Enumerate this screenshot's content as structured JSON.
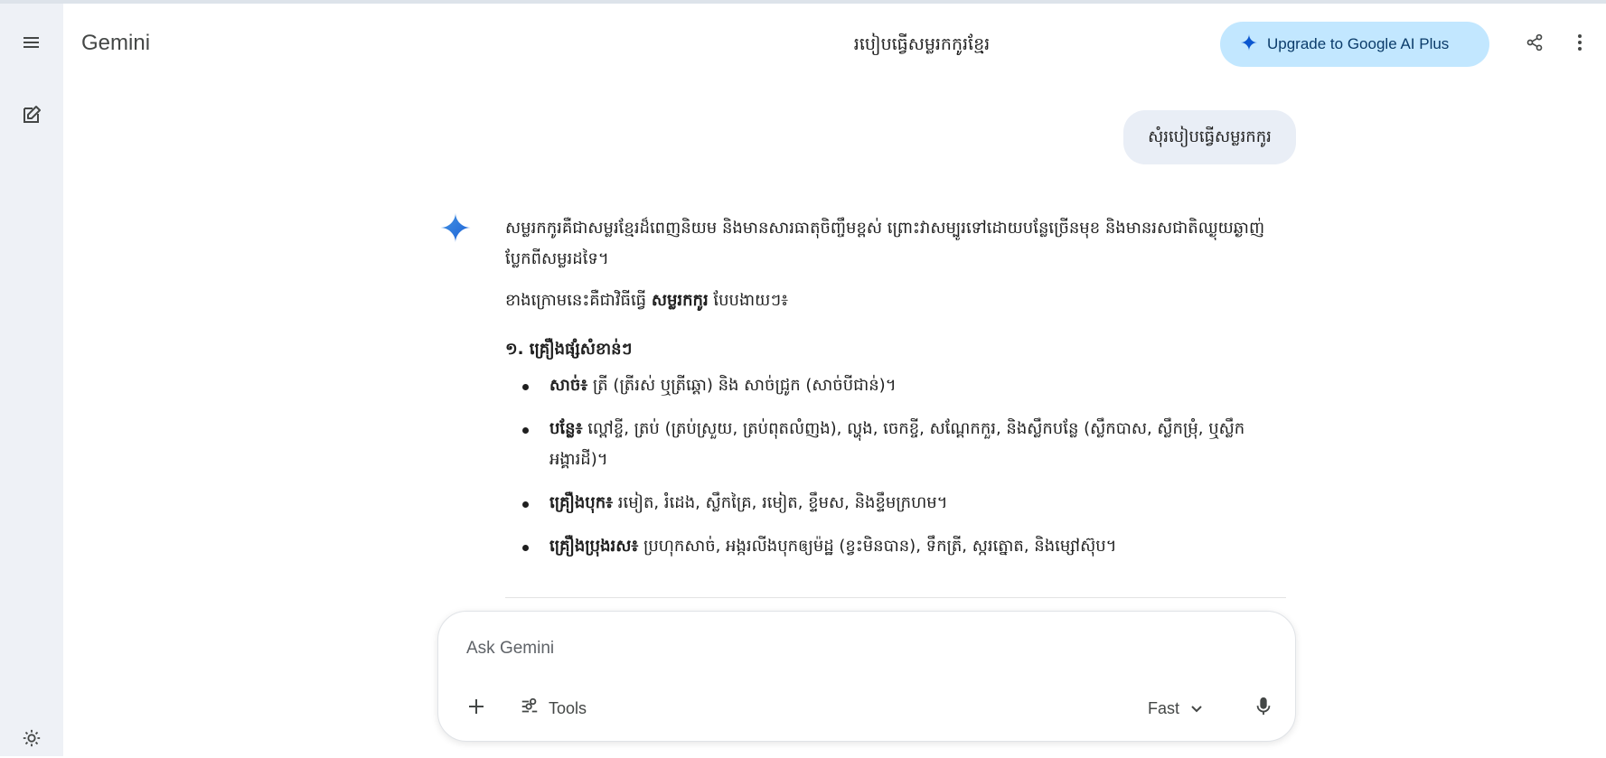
{
  "app": {
    "brand": "Gemini"
  },
  "header": {
    "chat_title": "របៀបធ្វើសម្លរកកូរខ្មែរ",
    "upgrade_label": "Upgrade to Google AI Plus"
  },
  "icons": {
    "menu": "menu-icon",
    "new_chat": "edit-icon",
    "settings": "gear-icon",
    "share": "share-icon",
    "more": "more-vert-icon",
    "spark": "gemini-spark-icon",
    "add": "plus-icon",
    "tools": "tools-icon",
    "chevron": "chevron-down-icon",
    "mic": "mic-icon"
  },
  "colors": {
    "accent": "#1a73e8",
    "upgrade_bg": "#c2e7ff",
    "rail_bg": "#eef1f6",
    "user_bubble_bg": "#e9eef6"
  },
  "conversation": {
    "user_message": "សុំរបៀបធ្វើសម្លរកកូរ",
    "response": {
      "intro": "សម្លរកកូរគឺជាសម្លរខ្មែរដ៏ពេញនិយម និងមានសារធាតុចិញ្ចឹមខ្ពស់ ព្រោះវាសម្បូរទៅដោយបន្លែច្រើនមុខ និងមានរសជាតិឈ្ងុយឆ្ងាញ់ប្លែកពីសម្លរដទៃ។",
      "lead_before": "ខាងក្រោមនេះគឺជាវិធីធ្វើ ",
      "lead_bold": "សម្លរកកូរ",
      "lead_after": " បែបងាយៗ៖",
      "section_heading": "១. គ្រឿងផ្សំសំខាន់ៗ",
      "items": [
        {
          "label": "សាច់៖",
          "text": " ត្រី (ត្រីរស់ ឬត្រីឆ្តោ) និង សាច់ជ្រូក (សាច់បីជាន់)។"
        },
        {
          "label": "បន្លែ៖",
          "text": " ល្ពៅខ្ចី, ត្រប់ (ត្រប់ស្រួយ, ត្រប់ពុតលំញង), ល្ហុង, ចេកខ្ចី, សណ្តែកកួរ, និងស្លឹកបន្លែ (ស្លឹកបាស, ស្លឹកម្រុំ, ឬស្លឹកអង្គារដី)។"
        },
        {
          "label": "គ្រឿងបុក៖",
          "text": " រមៀត, រំដេង, ស្លឹកគ្រៃ, រមៀត, ខ្ទឹមស, និងខ្ទឹមក្រហម។"
        },
        {
          "label": "គ្រឿងប្រុងរស៖",
          "text": " ប្រហុកសាច់, អង្ករលីងបុកឲ្យម៉ដ្ឋ (ខ្វះមិនបាន), ទឹកត្រី, ស្ករត្នោត, និងម្សៅស៊ុប។"
        }
      ]
    }
  },
  "composer": {
    "placeholder": "Ask Gemini",
    "tools_label": "Tools",
    "mode_label": "Fast"
  }
}
